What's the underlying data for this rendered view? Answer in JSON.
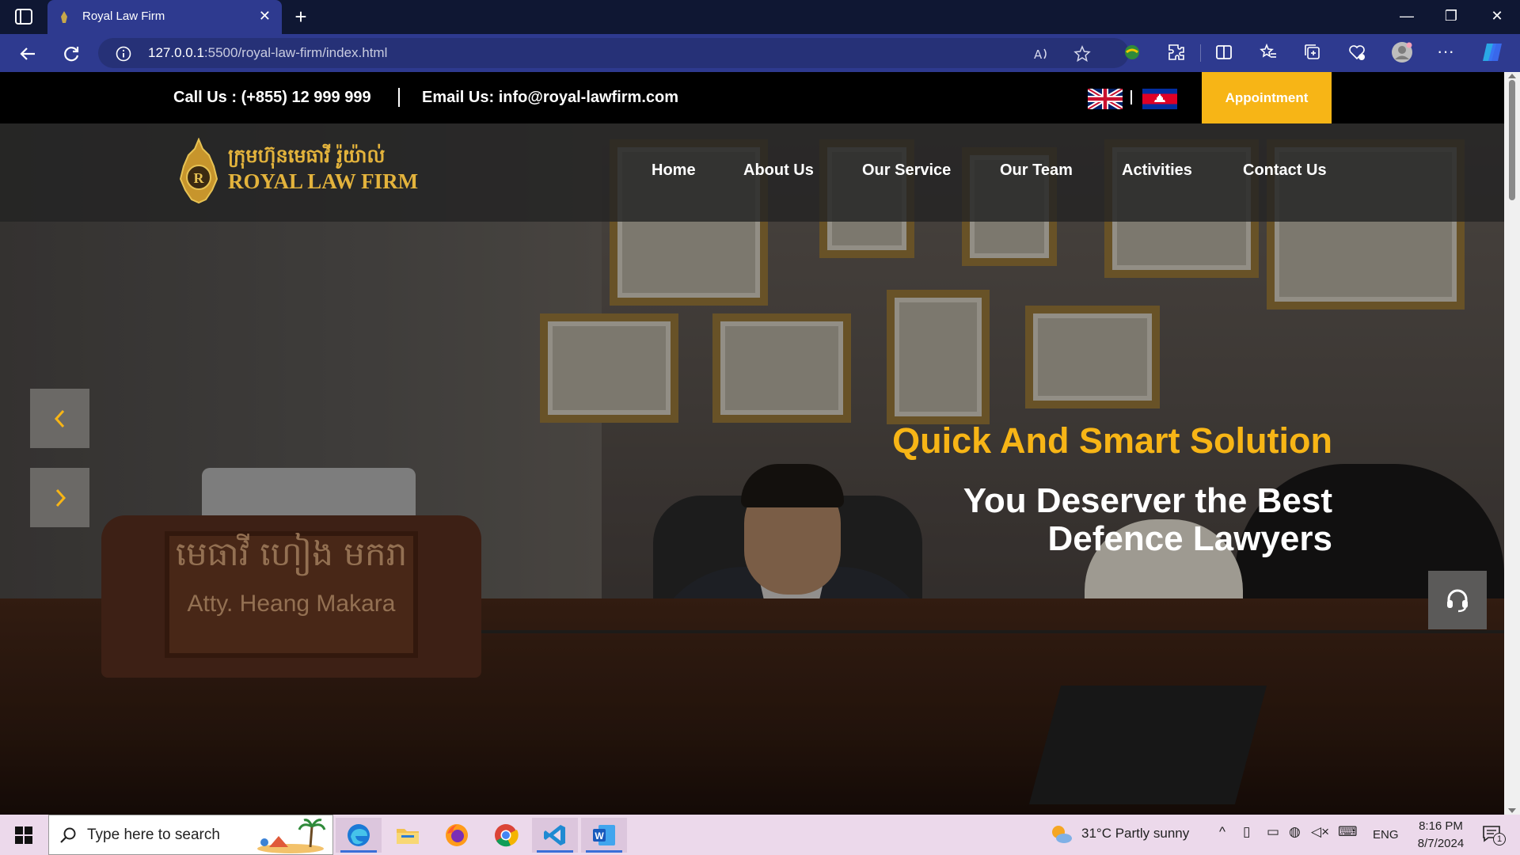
{
  "browser": {
    "tab_title": "Royal Law Firm",
    "url_host": "127.0.0.1",
    "url_path": ":5500/royal-law-firm/index.html"
  },
  "topbar": {
    "call": "Call Us : (+855) 12 999 999",
    "email": "Email Us: info@royal-lawfirm.com",
    "appointment": "Appointment",
    "lang_sep": "|"
  },
  "logo": {
    "khmer": "ក្រុមហ៊ុនមេធាវី រ៉ូយ៉ាល់",
    "english": "ROYAL LAW FIRM"
  },
  "nav": {
    "items": [
      "Home",
      "About Us",
      "Our Service",
      "Our Team",
      "Activities",
      "Contact Us"
    ]
  },
  "hero": {
    "tagline": "Quick And Smart Solution",
    "headline_line1": "You Deserver the Best",
    "headline_line2": "Defence Lawyers",
    "nameplate_khmer": "មេធាវី ហៀង មករា",
    "nameplate_en": "Atty. Heang Makara"
  },
  "taskbar": {
    "search_placeholder": "Type here to search",
    "weather": "31°C  Partly sunny",
    "lang": "ENG",
    "time": "8:16 PM",
    "date": "8/7/2024",
    "notifications": "1"
  },
  "colors": {
    "accent": "#f7b516",
    "chrome": "#2e3a8f",
    "tabbar": "#0f1733"
  }
}
